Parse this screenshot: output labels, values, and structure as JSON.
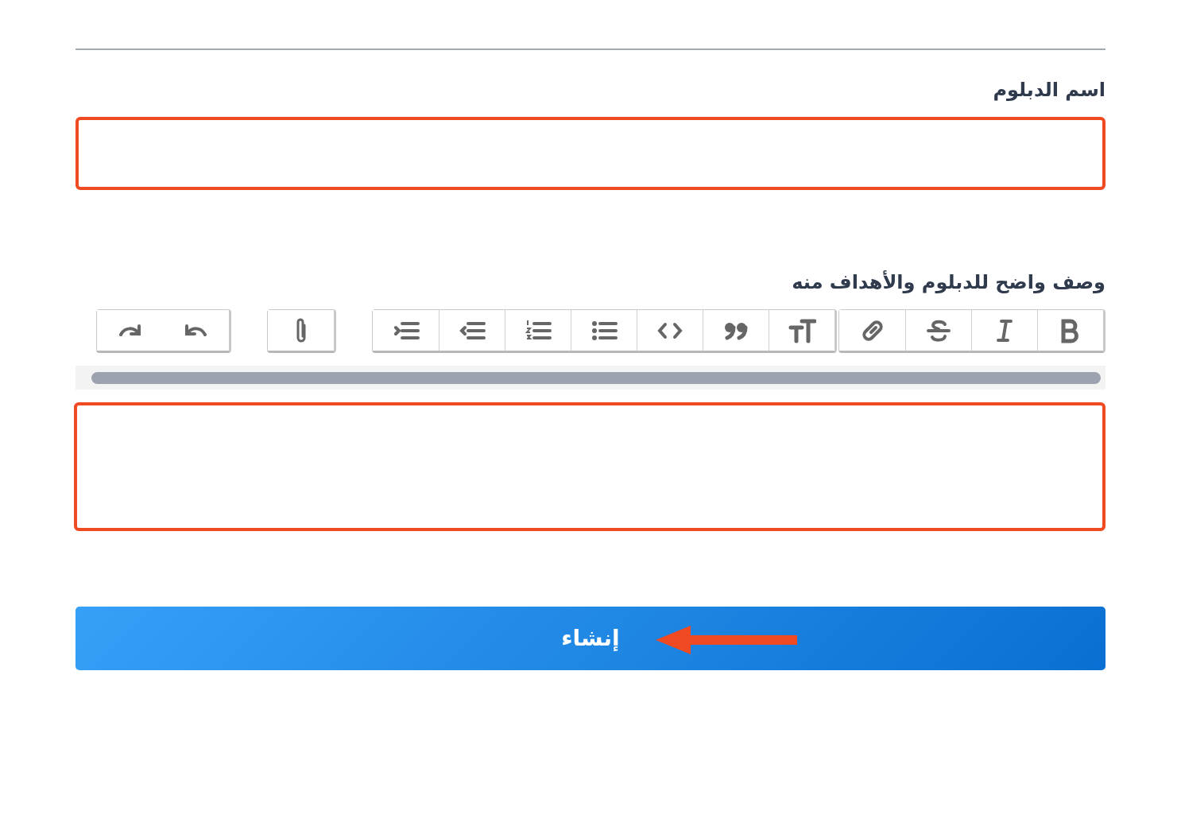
{
  "form": {
    "name_field": {
      "label": "اسم الدبلوم",
      "highlighted": true
    },
    "description_field": {
      "label": "وصف واضح للدبلوم والأهداف منه",
      "highlighted": true,
      "toolbar": [
        {
          "buttons": [
            {
              "kind": "bold"
            },
            {
              "kind": "italic"
            },
            {
              "kind": "strike"
            },
            {
              "kind": "link"
            }
          ]
        },
        {
          "buttons": [
            {
              "kind": "heading"
            },
            {
              "kind": "quote"
            },
            {
              "kind": "code"
            },
            {
              "kind": "bullets"
            },
            {
              "kind": "numbers"
            },
            {
              "kind": "outdent"
            },
            {
              "kind": "indent"
            }
          ]
        },
        {
          "buttons": [
            {
              "kind": "attach"
            }
          ]
        },
        {
          "buttons": [
            {
              "kind": "undo"
            },
            {
              "kind": "redo"
            }
          ]
        }
      ]
    },
    "submit": {
      "label": "إنشاء",
      "pointer_arrow": true
    }
  }
}
